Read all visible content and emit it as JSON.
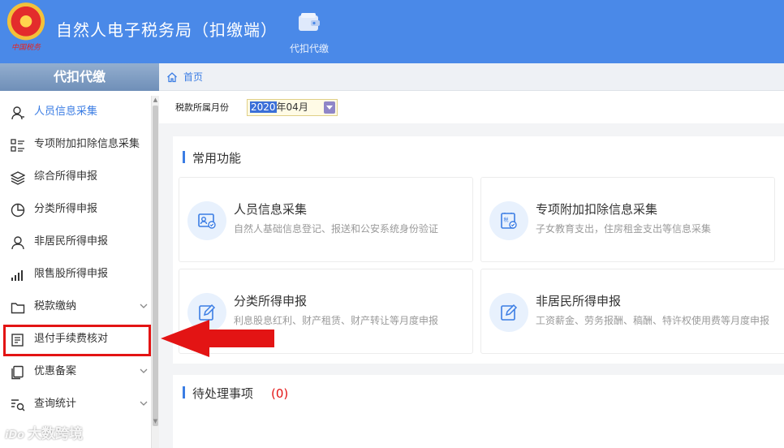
{
  "header": {
    "emblem_caption": "中国税务",
    "app_title": "自然人电子税务局（扣缴端）",
    "module_label": "代扣代缴"
  },
  "sidebar": {
    "title": "代扣代缴",
    "items": [
      {
        "label": "人员信息采集",
        "icon": "person-icon",
        "active": true
      },
      {
        "label": "专项附加扣除信息采集",
        "icon": "list-icon"
      },
      {
        "label": "综合所得申报",
        "icon": "layers-icon"
      },
      {
        "label": "分类所得申报",
        "icon": "pie-icon"
      },
      {
        "label": "非居民所得申报",
        "icon": "user-icon"
      },
      {
        "label": "限售股所得申报",
        "icon": "bar-chart-icon"
      },
      {
        "label": "税款缴纳",
        "icon": "folder-icon",
        "expandable": true
      },
      {
        "label": "退付手续费核对",
        "icon": "receipt-icon",
        "highlighted": true
      },
      {
        "label": "优惠备案",
        "icon": "copy-icon",
        "expandable": true
      },
      {
        "label": "查询统计",
        "icon": "search-list-icon",
        "expandable": true
      }
    ]
  },
  "breadcrumb": {
    "home": "首页"
  },
  "toolbar": {
    "month_label": "税款所属月份",
    "month_year": "2020",
    "month_rest": "年04月"
  },
  "common": {
    "title": "常用功能",
    "cards": [
      {
        "title": "人员信息采集",
        "desc": "自然人基础信息登记、报送和公安系统身份验证",
        "icon": "id-card-icon"
      },
      {
        "title": "专项附加扣除信息采集",
        "desc": "子女教育支出，住房租金支出等信息采集",
        "icon": "tax-form-icon"
      },
      {
        "title": "分类所得申报",
        "desc": "利息股息红利、财产租赁、财产转让等月度申报",
        "icon": "edit-icon"
      },
      {
        "title": "非居民所得申报",
        "desc": "工资薪金、劳务报酬、稿酬、特许权使用费等月度申报",
        "icon": "edit-icon"
      }
    ]
  },
  "pending": {
    "title": "待处理事项",
    "count": "(0)"
  },
  "watermark": {
    "logo": "iDo",
    "text": "大数跨境"
  },
  "colors": {
    "header": "#4a89e8",
    "accent": "#3b7de4",
    "alert": "#e31414"
  }
}
